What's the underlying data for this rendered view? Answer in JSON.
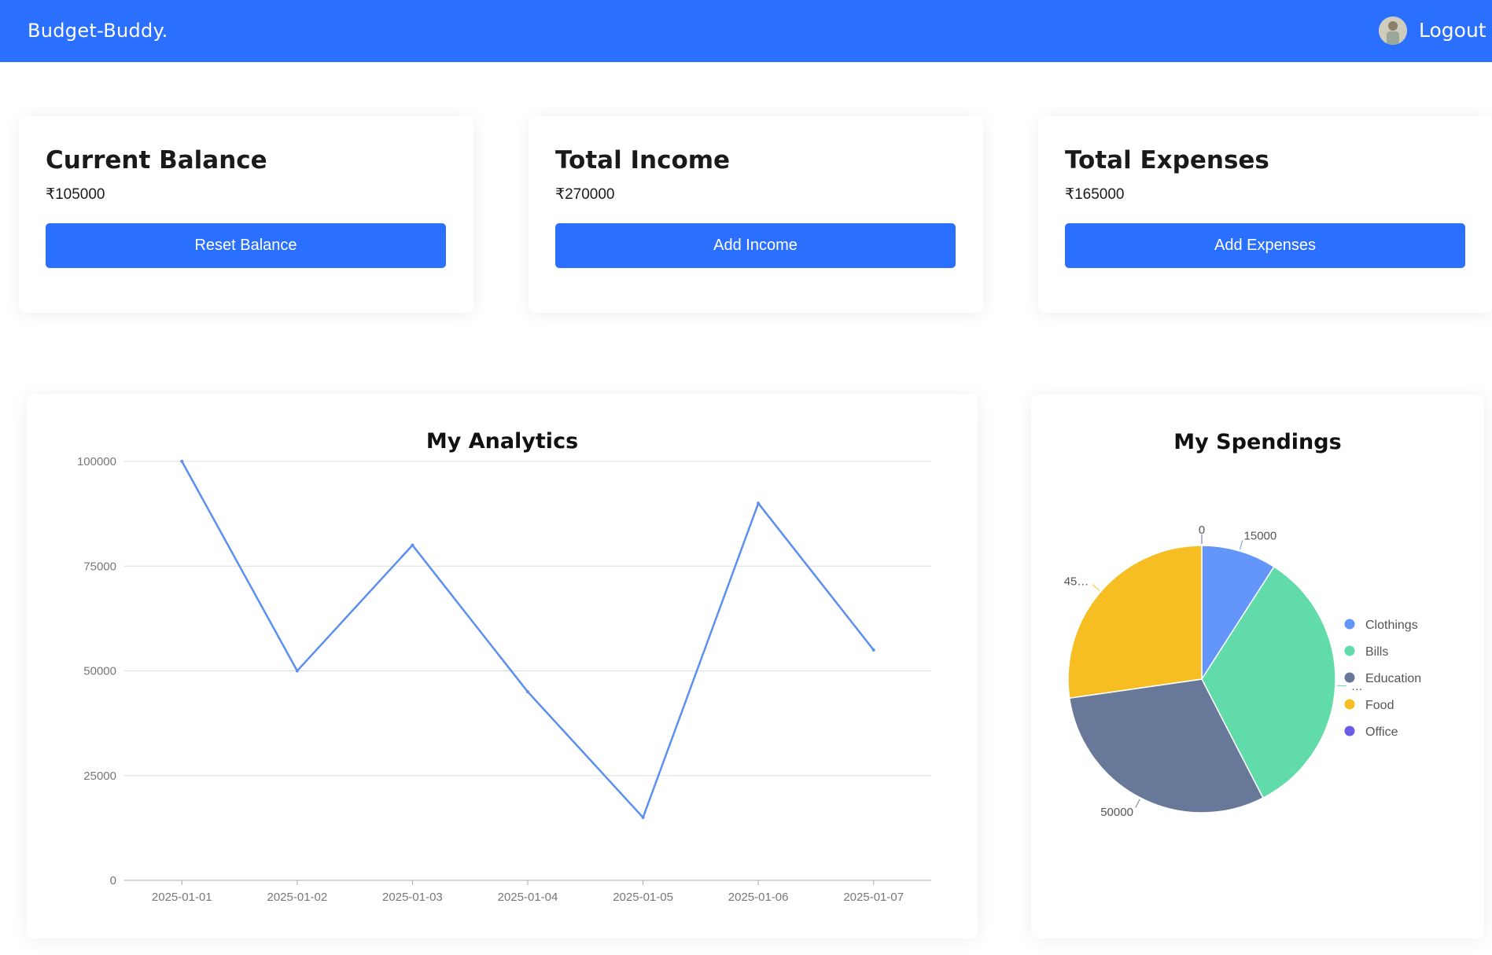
{
  "navbar": {
    "brand": "Budget-Buddy.",
    "logout_label": "Logout",
    "color": "#2b6ffe"
  },
  "cards": [
    {
      "title": "Current Balance",
      "value": "₹105000",
      "button_label": "Reset Balance"
    },
    {
      "title": "Total Income",
      "value": "₹270000",
      "button_label": "Add Income"
    },
    {
      "title": "Total Expenses",
      "value": "₹165000",
      "button_label": "Add Expenses"
    }
  ],
  "analytics": {
    "title": "My Analytics",
    "chart_data": {
      "type": "line",
      "x": [
        "2025-01-01",
        "2025-01-02",
        "2025-01-03",
        "2025-01-04",
        "2025-01-05",
        "2025-01-06",
        "2025-01-07"
      ],
      "series": [
        {
          "values": [
            100000,
            50000,
            80000,
            45000,
            15000,
            90000,
            55000
          ],
          "color": "#5b8ff0"
        }
      ],
      "yticks": [
        "0",
        "25000",
        "50000",
        "75000",
        "100000"
      ],
      "ylim": [
        0,
        100000
      ],
      "grid": true
    }
  },
  "spendings": {
    "title": "My Spendings",
    "chart_data": {
      "type": "pie",
      "slices": [
        {
          "name": "Clothings",
          "value": 15000,
          "label": "15000",
          "color": "#6495f8"
        },
        {
          "name": "Bills",
          "value": 55000,
          "label": "…",
          "color": "#60dba9"
        },
        {
          "name": "Education",
          "value": 50000,
          "label": "50000",
          "color": "#677898"
        },
        {
          "name": "Food",
          "value": 45000,
          "label": "45…",
          "color": "#f6be22"
        },
        {
          "name": "Office",
          "value": 0,
          "label": "0",
          "color": "#6a5ce8"
        }
      ],
      "legend": "right"
    }
  }
}
